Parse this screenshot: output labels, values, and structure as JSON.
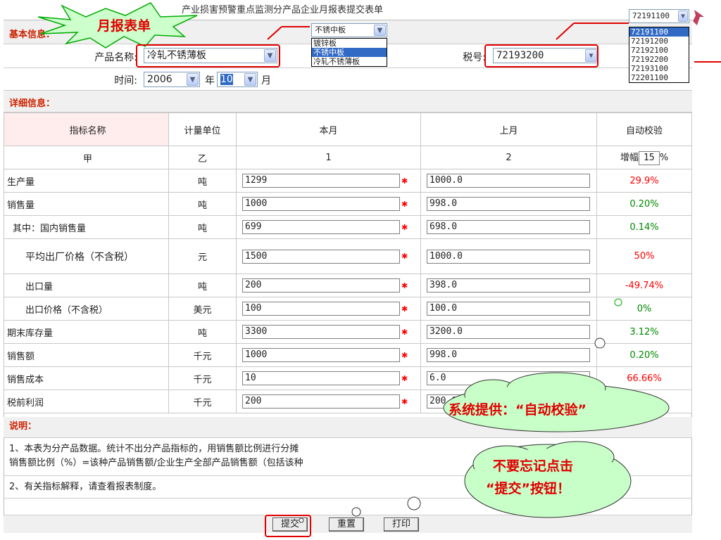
{
  "title": "产业损害预警重点监测分产品企业月报表提交表单",
  "badge": "月报表单",
  "basic_info_label": "基本信息：",
  "product_label": "产品名称:",
  "product_value": "冷轧不锈薄板",
  "tax_label": "税号:",
  "tax_value": "72193200",
  "time_label": "时间:",
  "year_value": "2006",
  "year_unit": "年",
  "month_value": "10",
  "month_unit": "月",
  "product_dropdown": {
    "current": "不锈中板",
    "options": [
      "镀锌板",
      "不锈中板",
      "冷轧不锈薄板"
    ],
    "selected_index": 1
  },
  "tax_dropdown": {
    "current": "72191100",
    "options": [
      "72191100",
      "72191200",
      "72192100",
      "72192200",
      "72193100",
      "72201100"
    ],
    "selected_index": 0
  },
  "detail_label": "详细信息：",
  "columns": {
    "name": "指标名称",
    "unit": "计量单位",
    "current": "本月",
    "previous": "上月",
    "check": "自动校验"
  },
  "index_row": {
    "name": "甲",
    "unit": "乙",
    "current": "1",
    "previous": "2",
    "growth_label": "增幅",
    "growth_value": "15",
    "growth_unit": "%"
  },
  "rows": [
    {
      "name": "生产量",
      "unit": "吨",
      "current": "1299",
      "previous": "1000.0",
      "check": "29.9%",
      "status": "red"
    },
    {
      "name": "销售量",
      "unit": "吨",
      "current": "1000",
      "previous": "998.0",
      "check": "0.20%",
      "status": "green"
    },
    {
      "name": "其中：国内销售量",
      "unit": "吨",
      "current": "699",
      "previous": "698.0",
      "check": "0.14%",
      "status": "green"
    },
    {
      "name": "平均出厂价格（不含税）",
      "unit": "元",
      "current": "1500",
      "previous": "1000.0",
      "check": "50%",
      "status": "red"
    },
    {
      "name": "出口量",
      "unit": "吨",
      "current": "200",
      "previous": "398.0",
      "check": "-49.74%",
      "status": "red"
    },
    {
      "name": "出口价格（不含税）",
      "unit": "美元",
      "current": "100",
      "previous": "100.0",
      "check": "0%",
      "status": "green"
    },
    {
      "name": "期末库存量",
      "unit": "吨",
      "current": "3300",
      "previous": "3200.0",
      "check": "3.12%",
      "status": "green"
    },
    {
      "name": "销售额",
      "unit": "千元",
      "current": "1000",
      "previous": "998.0",
      "check": "0.20%",
      "status": "green"
    },
    {
      "name": "销售成本",
      "unit": "千元",
      "current": "10",
      "previous": "6.0",
      "check": "66.66%",
      "status": "red"
    },
    {
      "name": "税前利润",
      "unit": "千元",
      "current": "200",
      "previous": "200.0",
      "check": "",
      "status": "green"
    }
  ],
  "notes_label": "说明：",
  "note1": "1、本表为分产品数据。统计不出分产品指标的，用销售额比例进行分摊",
  "note1b": "销售额比例（%）=该种产品销售额/企业生产全部产品销售额（包括该种",
  "note2": "2、有关指标解释，请查看报表制度。",
  "buttons": {
    "submit": "提交",
    "reset": "重置",
    "print": "打印"
  },
  "callout1": "系统提供：“自动校验”",
  "callout2a": "不要忘记点击",
  "callout2b": "“提交”按钮！",
  "colors": {
    "accent_red": "#e00000",
    "cloud_fill": "#c8ffc8",
    "burst_fill": "#ccffcc"
  }
}
